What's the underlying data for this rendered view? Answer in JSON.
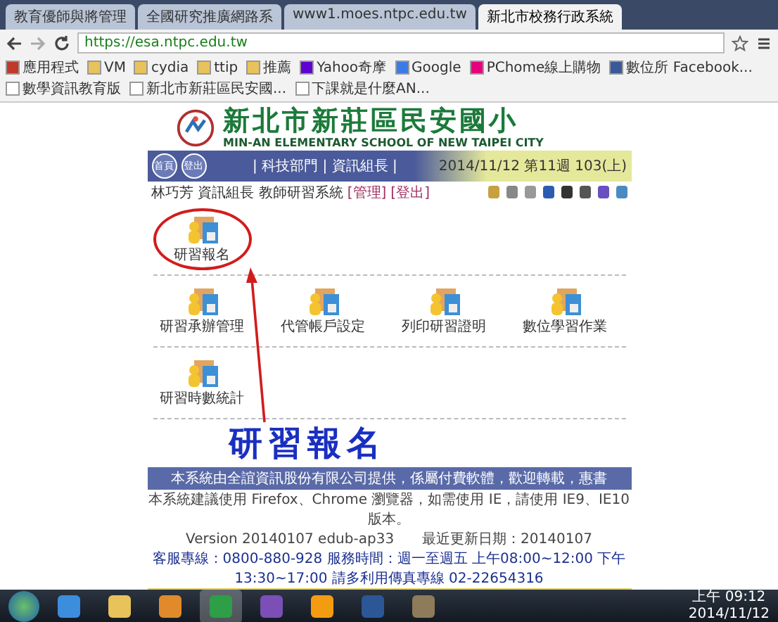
{
  "browser": {
    "tabs": [
      {
        "label": "教育優師與將管理",
        "selected": false
      },
      {
        "label": "全國研究推廣網路系",
        "selected": false
      },
      {
        "label": "www1.moes.ntpc.edu.tw",
        "selected": false
      },
      {
        "label": "新北市校務行政系統",
        "selected": true
      }
    ],
    "url": "https://esa.ntpc.edu.tw",
    "bookmarks": [
      {
        "label": "應用程式",
        "kind": "apps"
      },
      {
        "label": "VM",
        "kind": "folder"
      },
      {
        "label": "cydia",
        "kind": "folder"
      },
      {
        "label": "ttip",
        "kind": "folder"
      },
      {
        "label": "推薦",
        "kind": "folder"
      },
      {
        "label": "Yahoo奇摩",
        "kind": "yahoo"
      },
      {
        "label": "Google",
        "kind": "google"
      },
      {
        "label": "PChome線上購物",
        "kind": "pchome"
      },
      {
        "label": "數位所 Facebook...",
        "kind": "facebook"
      },
      {
        "label": "數學資訊教育版",
        "kind": "page"
      },
      {
        "label": "新北市新莊區民安國...",
        "kind": "page"
      },
      {
        "label": "下課就是什麼AN...",
        "kind": "page"
      }
    ]
  },
  "header": {
    "title": "新北市新莊區民安國小",
    "subtitle": "MIN-AN ELEMENTARY SCHOOL OF NEW TAIPEI CITY"
  },
  "navbar": {
    "buttons": [
      "首頁",
      "登出"
    ],
    "links": "| 科技部門 | 資訊組長 |",
    "date": "2014/11/12 第11週 103(上)",
    "user": "林巧芳 資訊組長 教師研習系統",
    "actions": [
      "[管理]",
      "[登出]"
    ]
  },
  "menu": [
    [
      {
        "label": "研習報名",
        "circled": true
      }
    ],
    [
      {
        "label": "研習承辦管理",
        "circled": false
      },
      {
        "label": "代管帳戶設定",
        "circled": false
      },
      {
        "label": "列印研習證明",
        "circled": false
      },
      {
        "label": "數位學習作業",
        "circled": false
      }
    ],
    [
      {
        "label": "研習時數統計",
        "circled": false
      }
    ]
  ],
  "annotation": "研習報名",
  "footer": {
    "notice": "本系統由全誼資訊股份有限公司提供，係屬付費軟體，歡迎轉載，惠書",
    "lines": [
      "本系統建議使用 Firefox、Chrome 瀏覽器，如需使用 IE，請使用 IE9、IE10 版本。",
      "Version 20140107 edub-ap33　　最近更新日期：20140107"
    ],
    "contact": "客服專線：0800-880-928 服務時間：週一至週五 上午08:00~12:00 下午13:30~17:00 請多利用傳真專線 02-22654316"
  },
  "taskbar": {
    "apps": [
      {
        "kind": "ie",
        "selected": false
      },
      {
        "kind": "folder",
        "selected": false
      },
      {
        "kind": "media",
        "selected": false
      },
      {
        "kind": "chrome",
        "selected": true
      },
      {
        "kind": "vs",
        "selected": false
      },
      {
        "kind": "orange",
        "selected": false
      },
      {
        "kind": "word",
        "selected": false
      },
      {
        "kind": "film",
        "selected": false
      }
    ],
    "time": "上午 09:12",
    "date": "2014/11/12"
  }
}
